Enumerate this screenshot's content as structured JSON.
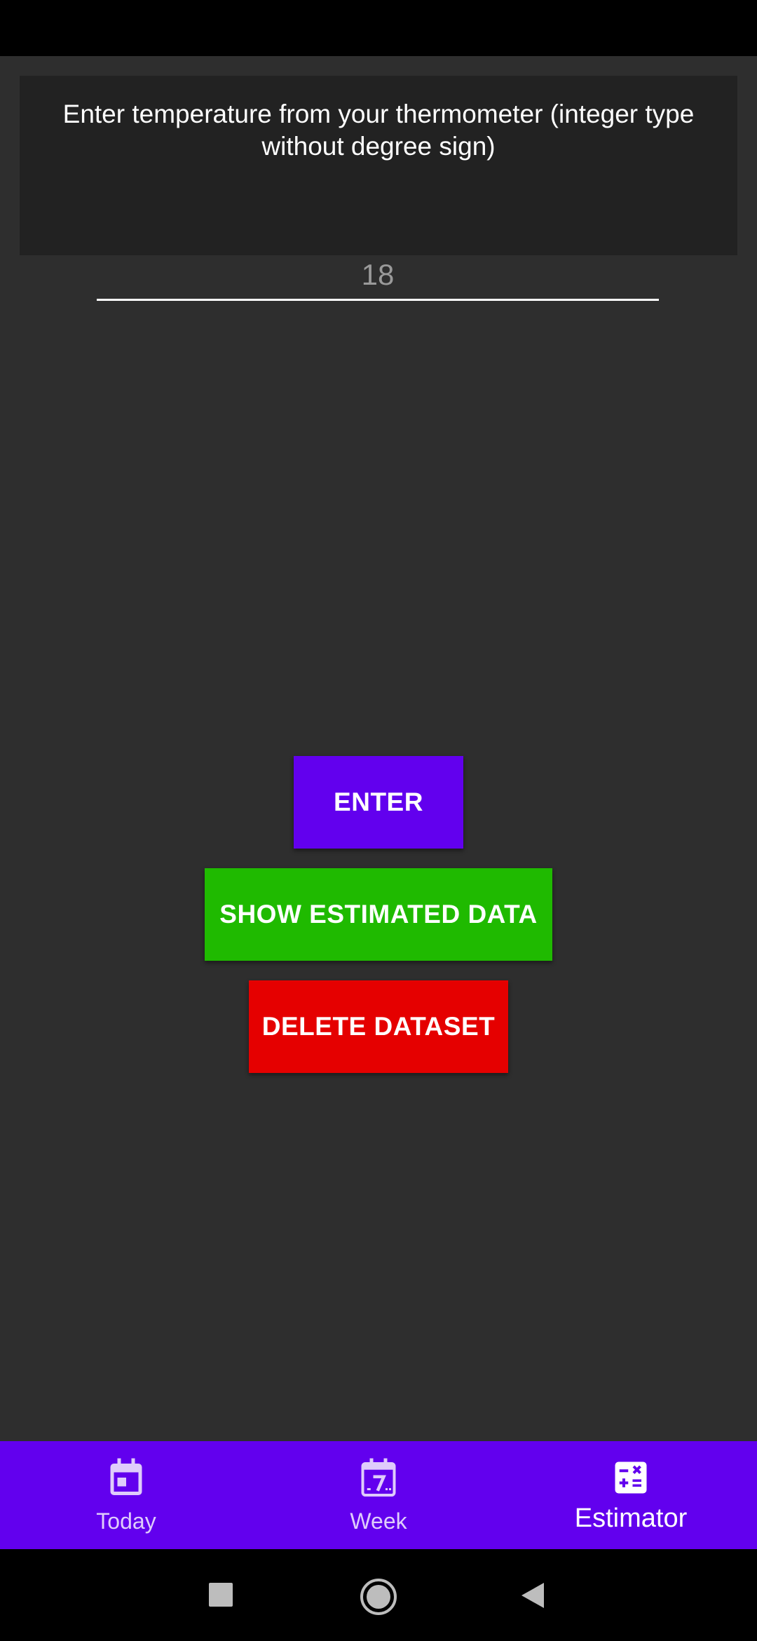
{
  "input_card": {
    "prompt": "Enter temperature from your thermometer (integer type without degree sign)",
    "input_value": "",
    "input_placeholder": "18"
  },
  "buttons": {
    "enter_label": "ENTER",
    "show_label": "SHOW ESTIMATED DATA",
    "delete_label": "DELETE DATASET"
  },
  "colors": {
    "accent": "#6200ee",
    "show_button": "#1fba00",
    "delete_button": "#e50000",
    "background": "#2e2e2e",
    "card": "#222222"
  },
  "bottom_nav": {
    "items": [
      {
        "label": "Today",
        "icon": "calendar-today-icon",
        "active": false
      },
      {
        "label": "Week",
        "icon": "calendar-week-icon",
        "active": false
      },
      {
        "label": "Estimator",
        "icon": "calculator-icon",
        "active": true
      }
    ]
  },
  "system_nav": {
    "icons": [
      "recents-square-icon",
      "home-circle-icon",
      "back-triangle-icon"
    ]
  }
}
